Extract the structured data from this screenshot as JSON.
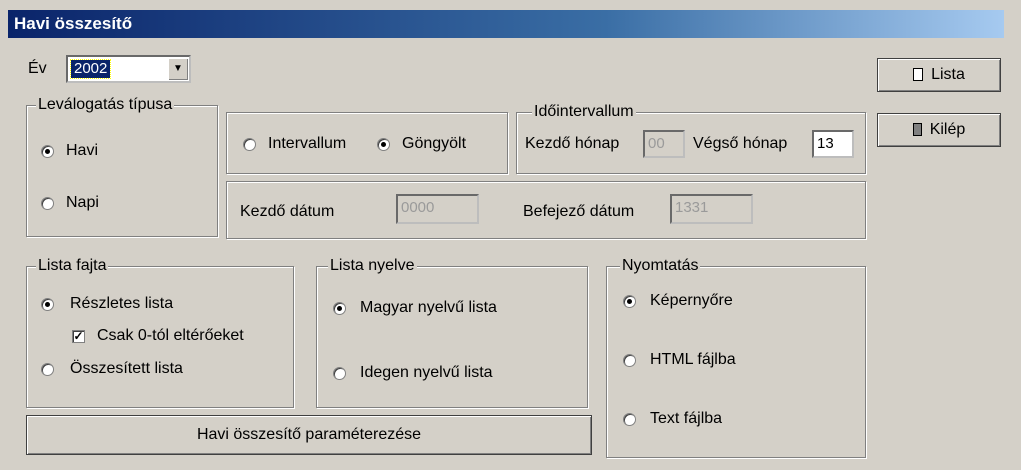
{
  "window": {
    "title": "Havi összesítő"
  },
  "year": {
    "label": "Év",
    "value": "2002"
  },
  "buttons": {
    "lista": "Lista",
    "kilep": "Kilép",
    "params": "Havi összesítő paraméterezése"
  },
  "levalogatas": {
    "title": "Leválogatás típusa",
    "options": [
      "Havi",
      "Napi"
    ],
    "selected": 0
  },
  "mode": {
    "options": [
      "Intervallum",
      "Göngyölt"
    ],
    "selected": 1
  },
  "idointervallum": {
    "title": "Időintervallum",
    "kezdo_label": "Kezdő hónap",
    "kezdo_value": "00",
    "vegso_label": "Végső hónap",
    "vegso_value": "13"
  },
  "datum": {
    "kezdo_label": "Kezdő dátum",
    "kezdo_value": "0000",
    "befejezo_label": "Befejező dátum",
    "befejezo_value": "1331"
  },
  "lista_fajta": {
    "title": "Lista fajta",
    "options": [
      "Részletes lista",
      "Összesített lista"
    ],
    "selected": 0,
    "checkbox_label": "Csak 0-tól eltérőeket",
    "checkbox_checked": true
  },
  "lista_nyelve": {
    "title": "Lista nyelve",
    "options": [
      "Magyar nyelvű lista",
      "Idegen nyelvű lista"
    ],
    "selected": 0
  },
  "nyomtatas": {
    "title": "Nyomtatás",
    "options": [
      "Képernyőre",
      "HTML fájlba",
      "Text fájlba"
    ],
    "selected": 0
  }
}
